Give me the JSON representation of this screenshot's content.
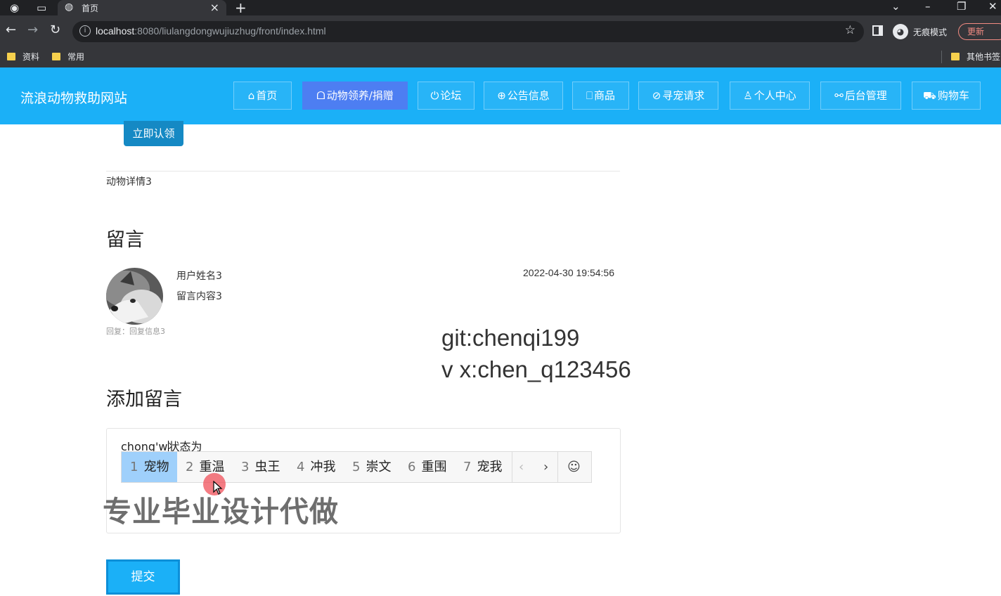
{
  "browser": {
    "tab_title": "首页",
    "url_host": "localhost",
    "url_rest": ":8080/liulangdongwujiuzhug/front/index.html",
    "incognito_label": "无痕模式",
    "update_label": "更新",
    "bookmarks": [
      "资料",
      "常用"
    ],
    "other_bookmarks": "其他书签"
  },
  "site": {
    "title": "流浪动物救助网站",
    "nav": [
      {
        "icon": "⌂",
        "label": "首页"
      },
      {
        "icon": "ᗝ",
        "label": "动物领养/捐赠"
      },
      {
        "icon": "⏻",
        "label": "论坛"
      },
      {
        "icon": "⊕",
        "label": "公告信息"
      },
      {
        "icon": "⎕",
        "label": "商品"
      },
      {
        "icon": "⊘",
        "label": "寻宠请求"
      },
      {
        "icon": "♙",
        "label": "个人中心"
      },
      {
        "icon": "⚯",
        "label": "后台管理"
      },
      {
        "icon": "⛟",
        "label": "购物车"
      }
    ],
    "active_nav": "动物领养/捐赠"
  },
  "detail": {
    "adopt_button": "立即认领",
    "text": "动物详情3"
  },
  "comments": {
    "title": "留言",
    "items": [
      {
        "user": "用户姓名3",
        "content": "留言内容3",
        "time": "2022-04-30 19:54:56",
        "reply": "回复：回复信息3"
      }
    ]
  },
  "watermark": {
    "git": "git:chenqi199",
    "vx": "v x:chen_q123456",
    "ad": "专业毕业设计代做"
  },
  "add_comment": {
    "title": "添加留言",
    "input_text_before_caret": "chong'w",
    "input_text_after_caret": "状态为",
    "submit_label": "提交"
  },
  "ime": {
    "candidates": [
      {
        "n": "1",
        "text": "宠物"
      },
      {
        "n": "2",
        "text": "重温"
      },
      {
        "n": "3",
        "text": "虫王"
      },
      {
        "n": "4",
        "text": "冲我"
      },
      {
        "n": "5",
        "text": "崇文"
      },
      {
        "n": "6",
        "text": "重围"
      },
      {
        "n": "7",
        "text": "宠我"
      }
    ],
    "selected": 0
  },
  "colors": {
    "header": "#1bb0f7",
    "nav_active": "#4d7ef2",
    "adopt_button": "#1589c4",
    "ime_selected": "#9fd0fb"
  }
}
